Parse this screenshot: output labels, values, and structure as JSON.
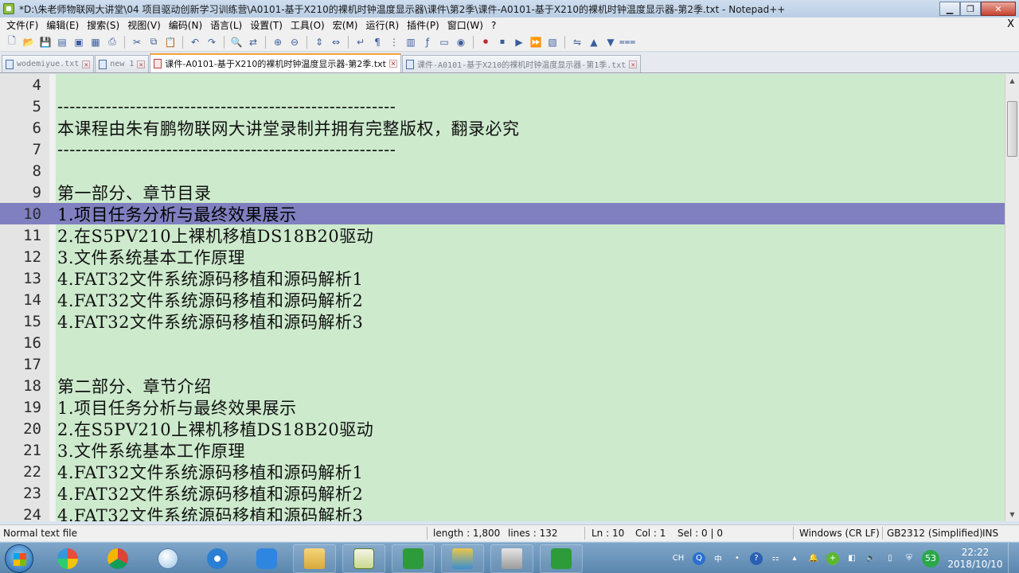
{
  "window": {
    "title": "*D:\\朱老师物联网大讲堂\\04 项目驱动创新学习训练营\\A0101-基于X210的裸机时钟温度显示器\\课件\\第2季\\课件-A0101-基于X210的裸机时钟温度显示器-第2季.txt - Notepad++",
    "min_label": "▁",
    "max_label": "❐",
    "close_label": "✕"
  },
  "menu": {
    "items": [
      "文件(F)",
      "编辑(E)",
      "搜索(S)",
      "视图(V)",
      "编码(N)",
      "语言(L)",
      "设置(T)",
      "工具(O)",
      "宏(M)",
      "运行(R)",
      "插件(P)",
      "窗口(W)",
      "?"
    ],
    "close": "X"
  },
  "tabs": [
    {
      "label": "wodemiyue.txt",
      "active": false,
      "icon": "doc-icon"
    },
    {
      "label": "new 1",
      "active": false,
      "icon": "doc-icon"
    },
    {
      "label": "课件-A0101-基于X210的裸机时钟温度显示器-第2季.txt",
      "active": true,
      "icon": "doc-modified-icon"
    },
    {
      "label": "课件-A0101-基于X210的裸机时钟温度显示器-第1季.txt",
      "active": false,
      "icon": "doc-icon"
    }
  ],
  "editor": {
    "current_line": 10,
    "lines": [
      {
        "n": "4",
        "text": ""
      },
      {
        "n": "5",
        "text": "--------------------------------------------------------"
      },
      {
        "n": "6",
        "text": "本课程由朱有鹏物联网大讲堂录制并拥有完整版权，翻录必究"
      },
      {
        "n": "7",
        "text": "--------------------------------------------------------"
      },
      {
        "n": "8",
        "text": ""
      },
      {
        "n": "9",
        "text": "第一部分、章节目录"
      },
      {
        "n": "10",
        "text": "1.项目任务分析与最终效果展示"
      },
      {
        "n": "11",
        "text": "2.在S5PV210上裸机移植DS18B20驱动"
      },
      {
        "n": "12",
        "text": "3.文件系统基本工作原理"
      },
      {
        "n": "13",
        "text": "4.FAT32文件系统源码移植和源码解析1"
      },
      {
        "n": "14",
        "text": "4.FAT32文件系统源码移植和源码解析2"
      },
      {
        "n": "15",
        "text": "4.FAT32文件系统源码移植和源码解析3"
      },
      {
        "n": "16",
        "text": ""
      },
      {
        "n": "17",
        "text": ""
      },
      {
        "n": "18",
        "text": "第二部分、章节介绍"
      },
      {
        "n": "19",
        "text": "1.项目任务分析与最终效果展示"
      },
      {
        "n": "20",
        "text": "2.在S5PV210上裸机移植DS18B20驱动"
      },
      {
        "n": "21",
        "text": "3.文件系统基本工作原理"
      },
      {
        "n": "22",
        "text": "4.FAT32文件系统源码移植和源码解析1"
      },
      {
        "n": "23",
        "text": "4.FAT32文件系统源码移植和源码解析2"
      },
      {
        "n": "24",
        "text": "4.FAT32文件系统源码移植和源码解析3"
      }
    ]
  },
  "status": {
    "file_type": "Normal text file",
    "length": "length : 1,800",
    "lines": "lines : 132",
    "ln": "Ln : 10",
    "col": "Col : 1",
    "sel": "Sel : 0 | 0",
    "eol": "Windows (CR LF)",
    "encoding": "GB2312 (Simplified)",
    "mode": "INS"
  },
  "taskbar": {
    "ime": "CH",
    "ime_mode": "中",
    "badge": "53",
    "time": "22:22",
    "date": "2018/10/10"
  },
  "colors": {
    "editor_bg": "#cdeacd",
    "current_line": "#8080c0",
    "active_tab_accent": "#f6a33a"
  }
}
